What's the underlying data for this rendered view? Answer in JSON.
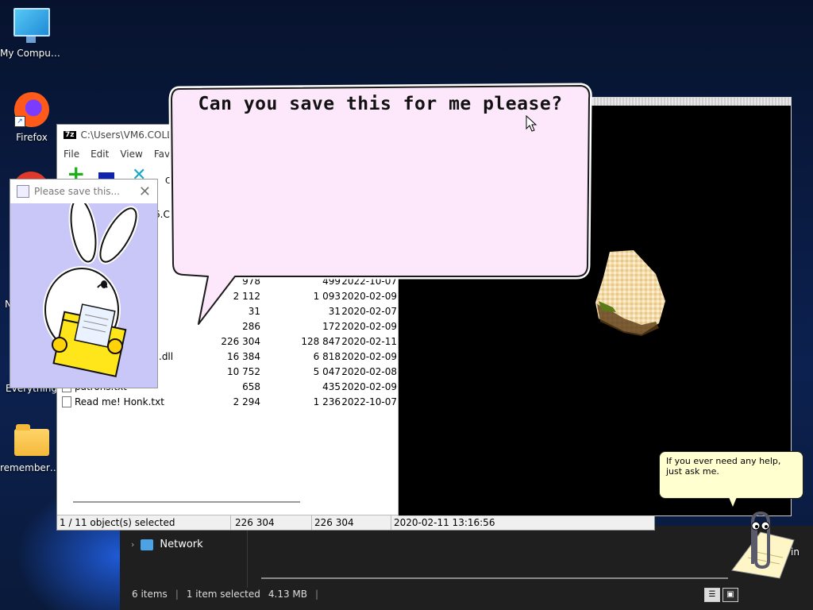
{
  "desktop": {
    "icons": [
      {
        "label": "My Computer",
        "icon": "monitor-icon"
      },
      {
        "label": "Firefox",
        "icon": "firefox-icon"
      },
      {
        "label": "remember_...",
        "icon": "folder-icon"
      }
    ],
    "partial_labels": {
      "letter_n": "N",
      "everything": "Everything"
    }
  },
  "zip_window": {
    "title": "C:\\Users\\VM6.COLLA...",
    "menu": [
      "File",
      "Edit",
      "View",
      "Favor"
    ],
    "toolbar_partial_label": "C",
    "address_partial": "6.CO",
    "rows": [
      {
        "name": "",
        "size": "978",
        "packed": "499",
        "date": "2022-10-07"
      },
      {
        "name": "",
        "size": "2 112",
        "packed": "1 093",
        "date": "2020-02-09"
      },
      {
        "name": "",
        "size": "31",
        "packed": "31",
        "date": "2020-02-07"
      },
      {
        "name": "",
        "size": "286",
        "packed": "172",
        "date": "2020-02-09"
      },
      {
        "name": "",
        "size": "226 304",
        "packed": "128 847",
        "date": "2020-02-11"
      },
      {
        "name": ".dll",
        "size": "16 384",
        "packed": "6 818",
        "date": "2020-02-09"
      },
      {
        "name": "",
        "size": "10 752",
        "packed": "5 047",
        "date": "2020-02-08"
      },
      {
        "name": "patrons.txt",
        "size": "658",
        "packed": "435",
        "date": "2020-02-09"
      },
      {
        "name": "Read me! Honk.txt",
        "size": "2 294",
        "packed": "1 236",
        "date": "2022-10-07"
      }
    ],
    "status": {
      "selected": "1 / 11 object(s) selected",
      "size": "226 304",
      "packed": "226 304",
      "modified": "2020-02-11 13:16:56"
    }
  },
  "bunny_window": {
    "title": "Please save this...",
    "close": "✕"
  },
  "speech": {
    "text": "Can you save this for me please?"
  },
  "explorer": {
    "nav_item": "Network",
    "status_items": "6 items",
    "status_selected": "1 item selected",
    "status_size": "4.13 MB"
  },
  "clippy": {
    "tip": "If you ever need any help, just ask me.",
    "partial_label": "in"
  },
  "colors": {
    "balloon_fill": "#fde8fb",
    "bunny_bg": "#c9c7f7",
    "tip_bg": "#ffffd0"
  }
}
